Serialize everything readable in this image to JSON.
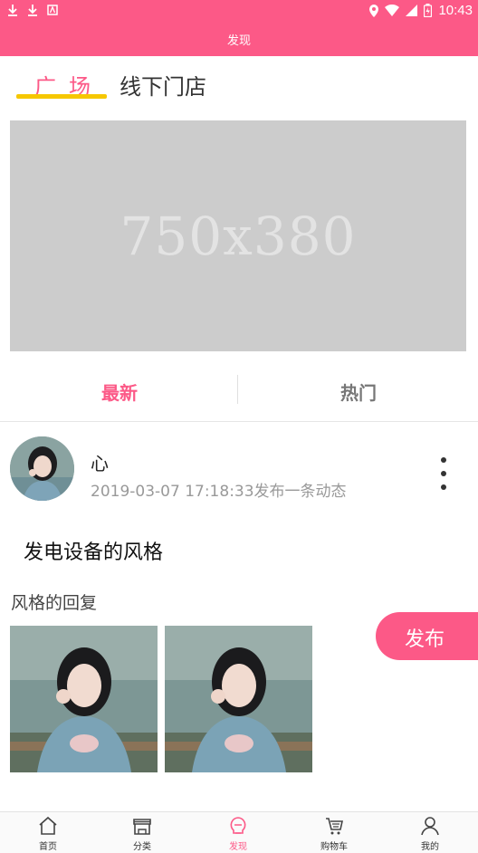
{
  "status_bar": {
    "time": "10:43"
  },
  "header": {
    "title": "发现"
  },
  "top_tabs": [
    {
      "label": "广场",
      "active": true
    },
    {
      "label": "线下门店",
      "active": false
    }
  ],
  "banner": {
    "placeholder_text": "750x380"
  },
  "sub_tabs": [
    {
      "label": "最新",
      "active": true
    },
    {
      "label": "热门",
      "active": false
    }
  ],
  "post": {
    "username": "心",
    "time_text": "2019-03-07 17:18:33发布一条动态",
    "title": "发电设备的风格",
    "reply": "风格的回复"
  },
  "publish_button": {
    "label": "发布"
  },
  "bottom_nav": [
    {
      "label": "首页",
      "icon": "home-icon",
      "active": false
    },
    {
      "label": "分类",
      "icon": "store-icon",
      "active": false
    },
    {
      "label": "发现",
      "icon": "discover-icon",
      "active": true
    },
    {
      "label": "购物车",
      "icon": "cart-icon",
      "active": false
    },
    {
      "label": "我的",
      "icon": "user-icon",
      "active": false
    }
  ],
  "colors": {
    "accent": "#fc5987",
    "underline": "#f6c700"
  }
}
